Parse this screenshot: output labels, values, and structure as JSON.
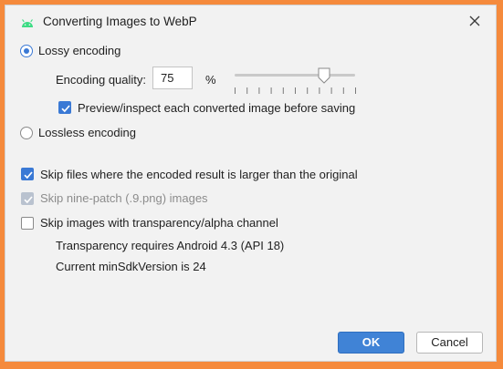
{
  "dialog": {
    "title": "Converting Images to WebP",
    "icon": "android-icon",
    "close_icon": "close-icon"
  },
  "lossy": {
    "label": "Lossy encoding",
    "selected": true,
    "quality_label": "Encoding quality:",
    "quality_value": "75",
    "percent_sign": "%",
    "slider_level_percent": 75,
    "preview_label": "Preview/inspect each converted image before saving",
    "preview_checked": true
  },
  "lossless": {
    "label": "Lossless encoding",
    "selected": false
  },
  "options": {
    "skip_larger_label": "Skip files where the encoded result is larger than the original",
    "skip_larger_checked": true,
    "skip_ninepatch_label": "Skip nine-patch (.9.png) images",
    "skip_ninepatch_checked": true,
    "skip_ninepatch_disabled": true,
    "skip_alpha_label": "Skip images with transparency/alpha channel",
    "skip_alpha_checked": false,
    "transparency_note": "Transparency requires Android 4.3 (API 18)",
    "min_sdk_note": "Current minSdkVersion is 24"
  },
  "buttons": {
    "ok": "OK",
    "cancel": "Cancel"
  },
  "colors": {
    "accent": "#3a79d5",
    "ok_button": "#4083d6",
    "frame": "#f58a3c",
    "android_green": "#3ddc84"
  }
}
